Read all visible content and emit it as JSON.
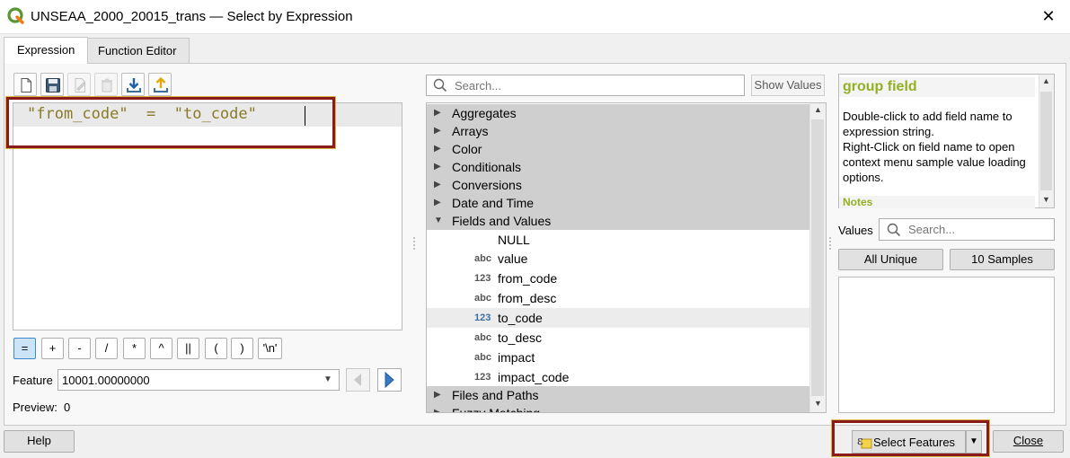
{
  "window": {
    "title": "UNSEAA_2000_20015_trans — Select by Expression",
    "close_glyph": "✕"
  },
  "tabs": [
    {
      "label": "Expression",
      "selected": true
    },
    {
      "label": "Function Editor",
      "selected": false
    }
  ],
  "toolbar": {
    "icons": [
      "new-file-icon",
      "save-icon",
      "edit-icon",
      "delete-icon",
      "import-icon",
      "export-icon"
    ]
  },
  "editor": {
    "expression": "\"from_code\"  =  \"to_code\""
  },
  "operators": [
    "=",
    "+",
    "-",
    "/",
    "*",
    "^",
    "||",
    "(",
    ")",
    "'\\n'"
  ],
  "feature": {
    "label": "Feature",
    "value": "10001.00000000"
  },
  "preview": {
    "label": "Preview:",
    "value": "0"
  },
  "function_search": {
    "placeholder": "Search...",
    "show_values_label": "Show Values"
  },
  "tree": {
    "groups_top": [
      "Aggregates",
      "Arrays",
      "Color",
      "Conditionals",
      "Conversions",
      "Date and Time"
    ],
    "expanded_group": "Fields and Values",
    "fields": [
      {
        "type": "",
        "name": "NULL"
      },
      {
        "type": "abc",
        "name": "value"
      },
      {
        "type": "123",
        "name": "from_code"
      },
      {
        "type": "abc",
        "name": "from_desc"
      },
      {
        "type": "123",
        "name": "to_code"
      },
      {
        "type": "abc",
        "name": "to_desc"
      },
      {
        "type": "abc",
        "name": "impact"
      },
      {
        "type": "123",
        "name": "impact_code"
      }
    ],
    "groups_bottom": [
      "Files and Paths",
      "Fuzzy Matching"
    ]
  },
  "help": {
    "title": "group field",
    "body": "Double-click to add field name to expression string.\nRight-Click on field name to open context menu sample value loading options.",
    "notes": "Notes"
  },
  "values": {
    "label": "Values",
    "placeholder": "Search...",
    "all_unique_label": "All Unique",
    "samples_label": "10 Samples"
  },
  "buttons": {
    "help": "Help",
    "select_features": "Select Features",
    "close": "Close"
  },
  "colors": {
    "highlight_border": "#8b1a1a",
    "help_title": "#93b023",
    "expression_text": "#8a7a28"
  }
}
